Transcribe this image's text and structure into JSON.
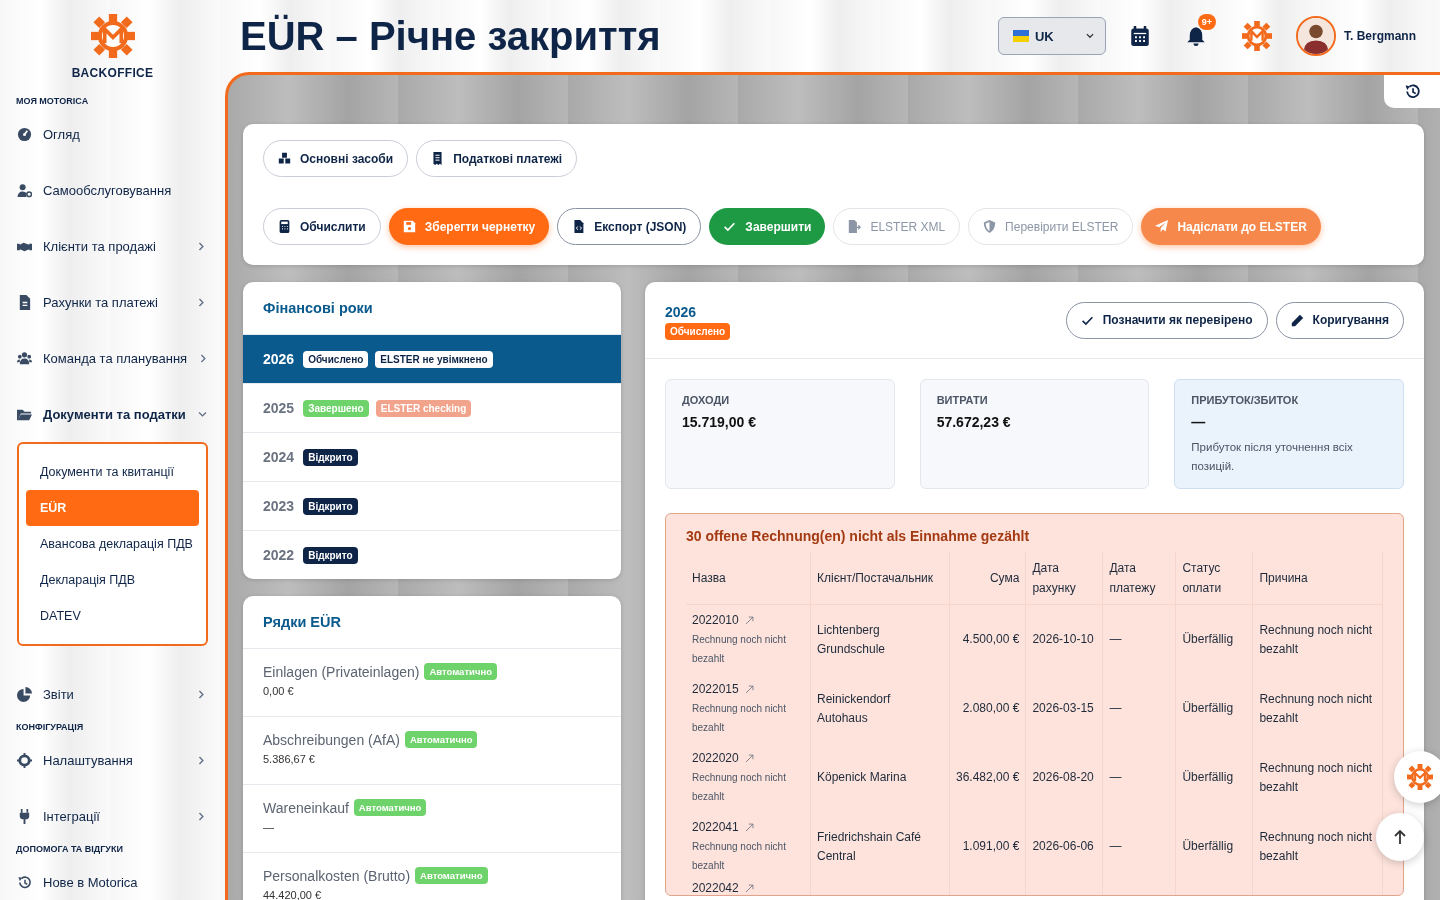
{
  "sidebar": {
    "brand": "BACKOFFICE",
    "sections": [
      {
        "heading": "МОЯ MOTORICA",
        "items": [
          {
            "label": "Огляд",
            "has_chevron": false,
            "selected": false
          },
          {
            "label": "Самообслуговування",
            "has_chevron": false,
            "selected": false
          },
          {
            "label": "Клієнти та продажі",
            "has_chevron": true,
            "expanded": false,
            "selected": false
          },
          {
            "label": "Рахунки та платежі",
            "has_chevron": true,
            "expanded": false,
            "selected": false
          },
          {
            "label": "Команда та планування",
            "has_chevron": true,
            "expanded": false,
            "selected": false
          },
          {
            "label": "Документи та податки",
            "has_chevron": true,
            "expanded": true,
            "selected": true,
            "children": [
              {
                "label": "Документи та квитанції",
                "selected": false
              },
              {
                "label": "EÜR",
                "selected": true
              },
              {
                "label": "Авансова декларація ПДВ",
                "selected": false
              },
              {
                "label": "Декларація ПДВ",
                "selected": false
              },
              {
                "label": "DATEV",
                "selected": false
              }
            ]
          },
          {
            "label": "Звіти",
            "has_chevron": true,
            "expanded": false,
            "selected": false
          }
        ]
      },
      {
        "heading": "КОНФІГУРАЦІЯ",
        "items": [
          {
            "label": "Налаштування",
            "has_chevron": true,
            "expanded": false,
            "selected": false
          },
          {
            "label": "Інтеграції",
            "has_chevron": true,
            "expanded": false,
            "selected": false
          }
        ]
      },
      {
        "heading": "ДОПОМОГА ТА ВІДГУКИ",
        "items": [
          {
            "label": "Нове в Motorica",
            "has_chevron": false,
            "selected": false
          }
        ]
      }
    ]
  },
  "header": {
    "title": "EÜR – Річне закриття",
    "language": "UK",
    "notifications": "9+",
    "user": "T. Bergmann"
  },
  "toolbar": {
    "rows": [
      [
        {
          "label": "Основні засоби",
          "kind": "outline"
        },
        {
          "label": "Податкові платежі",
          "kind": "outline"
        }
      ],
      [
        {
          "label": "Обчислити",
          "kind": "outline"
        },
        {
          "label": "Зберегти чернетку",
          "kind": "primary"
        },
        {
          "label": "Експорт (JSON)",
          "kind": "outline-dark"
        },
        {
          "label": "Завершити",
          "kind": "success"
        },
        {
          "label": "ELSTER XML",
          "kind": "disabled"
        },
        {
          "label": "Перевірити ELSTER",
          "kind": "disabled"
        },
        {
          "label": "Надіслати до ELSTER",
          "kind": "primary-light"
        }
      ]
    ]
  },
  "fiscal_years": {
    "title": "Фінансові роки",
    "items": [
      {
        "year": "2026",
        "selected": true,
        "badges": [
          {
            "text": "Обчислено",
            "color": "#ffffff"
          },
          {
            "text": "ELSTER не увімкнено",
            "color": "#ffffff"
          }
        ]
      },
      {
        "year": "2025",
        "selected": false,
        "badges": [
          {
            "text": "Завершено",
            "color": "#6fd36b"
          },
          {
            "text": "ELSTER checking",
            "color": "#f2a38b"
          }
        ]
      },
      {
        "year": "2024",
        "selected": false,
        "badges": [
          {
            "text": "Відкрито",
            "color": "#0f2548"
          }
        ]
      },
      {
        "year": "2023",
        "selected": false,
        "badges": [
          {
            "text": "Відкрито",
            "color": "#0f2548"
          }
        ]
      },
      {
        "year": "2022",
        "selected": false,
        "badges": [
          {
            "text": "Відкрито",
            "color": "#0f2548"
          }
        ]
      }
    ]
  },
  "eur_lines": {
    "title": "Рядки EÜR",
    "items": [
      {
        "name": "Einlagen (Privateinlagen)",
        "badge": "Автоматично",
        "value": "0,00 €"
      },
      {
        "name": "Abschreibungen (AfA)",
        "badge": "Автоматично",
        "value": "5.386,67 €"
      },
      {
        "name": "Wareneinkauf",
        "badge": "Автоматично",
        "value": "—"
      },
      {
        "name": "Personalkosten (Brutto)",
        "badge": "Автоматично",
        "value": "44.420,00 €"
      }
    ]
  },
  "detail": {
    "year": "2026",
    "status": "Обчислено",
    "actions": [
      "Позначити як перевірено",
      "Коригування"
    ],
    "cards": [
      {
        "label": "ДОХОДИ",
        "value": "15.719,00 €",
        "kind": "plain"
      },
      {
        "label": "ВИТРАТИ",
        "value": "57.672,23 €",
        "kind": "plain"
      },
      {
        "label": "ПРИБУТОК/ЗБИТОК",
        "value": "—",
        "note": "Прибуток після уточнення всіх позицій.",
        "kind": "highlight"
      }
    ],
    "warning": {
      "title": "30 offene Rechnung(en) nicht als Einnahme gezählt",
      "columns": [
        "Назва",
        "Клієнт/Постачальник",
        "Сума",
        "Дата рахунку",
        "Дата платежу",
        "Статус оплати",
        "Причина"
      ],
      "rows": [
        {
          "number": "2022010",
          "note": "Rechnung noch nicht bezahlt",
          "client": "Lichtenberg Grundschule",
          "amount": "4.500,00 €",
          "invoice_date": "2026-10-10",
          "payment_date": "—",
          "status": "Überfällig",
          "reason": "Rechnung noch nicht bezahlt"
        },
        {
          "number": "2022015",
          "note": "Rechnung noch nicht bezahlt",
          "client": "Reinickendorf Autohaus",
          "amount": "2.080,00 €",
          "invoice_date": "2026-03-15",
          "payment_date": "—",
          "status": "Überfällig",
          "reason": "Rechnung noch nicht bezahlt"
        },
        {
          "number": "2022020",
          "note": "Rechnung noch nicht bezahlt",
          "client": "Köpenick Marina",
          "amount": "36.482,00 €",
          "invoice_date": "2026-08-20",
          "payment_date": "—",
          "status": "Überfällig",
          "reason": "Rechnung noch nicht bezahlt"
        },
        {
          "number": "2022041",
          "note": "Rechnung noch nicht bezahlt",
          "client": "Friedrichshain Café Central",
          "amount": "1.091,00 €",
          "invoice_date": "2026-06-06",
          "payment_date": "—",
          "status": "Überfällig",
          "reason": "Rechnung noch nicht bezahlt"
        },
        {
          "number": "2022042"
        }
      ]
    }
  }
}
